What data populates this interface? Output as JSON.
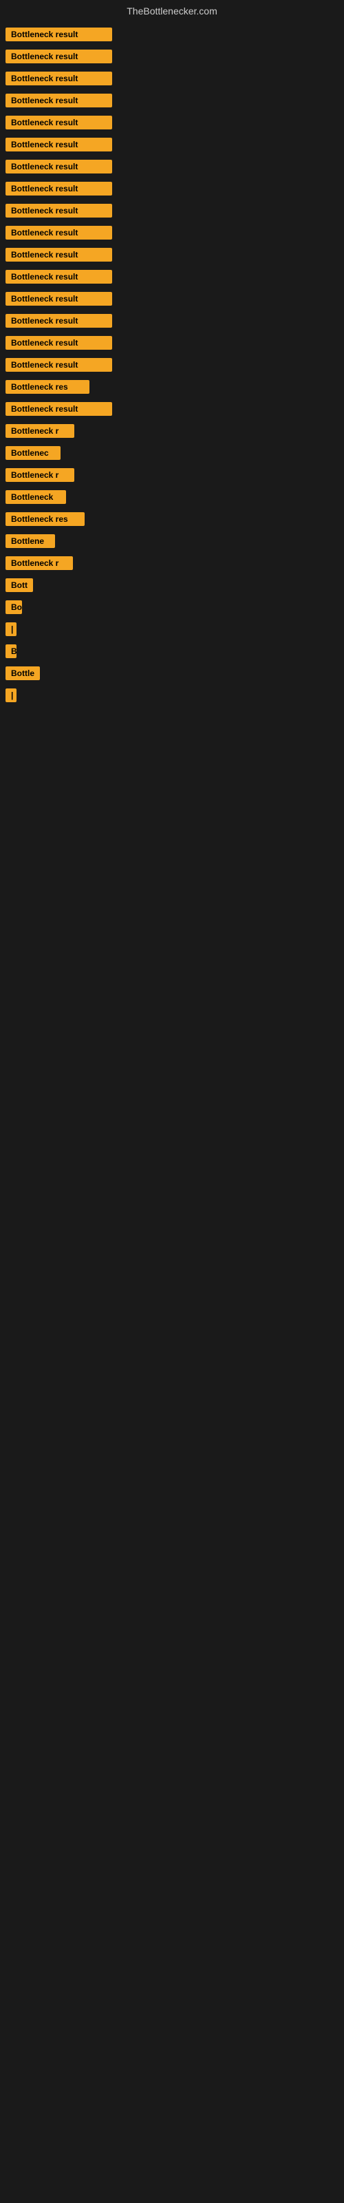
{
  "header": {
    "title": "TheBottlenecker.com"
  },
  "rows": [
    {
      "label": "Bottleneck result",
      "width": 155
    },
    {
      "label": "Bottleneck result",
      "width": 155
    },
    {
      "label": "Bottleneck result",
      "width": 155
    },
    {
      "label": "Bottleneck result",
      "width": 155
    },
    {
      "label": "Bottleneck result",
      "width": 155
    },
    {
      "label": "Bottleneck result",
      "width": 155
    },
    {
      "label": "Bottleneck result",
      "width": 155
    },
    {
      "label": "Bottleneck result",
      "width": 155
    },
    {
      "label": "Bottleneck result",
      "width": 155
    },
    {
      "label": "Bottleneck result",
      "width": 155
    },
    {
      "label": "Bottleneck result",
      "width": 155
    },
    {
      "label": "Bottleneck result",
      "width": 155
    },
    {
      "label": "Bottleneck result",
      "width": 155
    },
    {
      "label": "Bottleneck result",
      "width": 155
    },
    {
      "label": "Bottleneck result",
      "width": 155
    },
    {
      "label": "Bottleneck result",
      "width": 155
    },
    {
      "label": "Bottleneck res",
      "width": 122
    },
    {
      "label": "Bottleneck result",
      "width": 155
    },
    {
      "label": "Bottleneck r",
      "width": 100
    },
    {
      "label": "Bottlenec",
      "width": 80
    },
    {
      "label": "Bottleneck r",
      "width": 100
    },
    {
      "label": "Bottleneck",
      "width": 88
    },
    {
      "label": "Bottleneck res",
      "width": 115
    },
    {
      "label": "Bottlene",
      "width": 72
    },
    {
      "label": "Bottleneck r",
      "width": 98
    },
    {
      "label": "Bott",
      "width": 40
    },
    {
      "label": "Bo",
      "width": 24
    },
    {
      "label": "|",
      "width": 10
    },
    {
      "label": "B",
      "width": 14
    },
    {
      "label": "Bottle",
      "width": 50
    },
    {
      "label": "|",
      "width": 8
    },
    {
      "label": "",
      "width": 0
    },
    {
      "label": "",
      "width": 0
    },
    {
      "label": "",
      "width": 0
    },
    {
      "label": "",
      "width": 0
    },
    {
      "label": "",
      "width": 0
    },
    {
      "label": "",
      "width": 0
    },
    {
      "label": "",
      "width": 0
    },
    {
      "label": "",
      "width": 0
    }
  ],
  "colors": {
    "background": "#1a1a1a",
    "label_bg": "#f5a623",
    "header_text": "#cccccc"
  }
}
